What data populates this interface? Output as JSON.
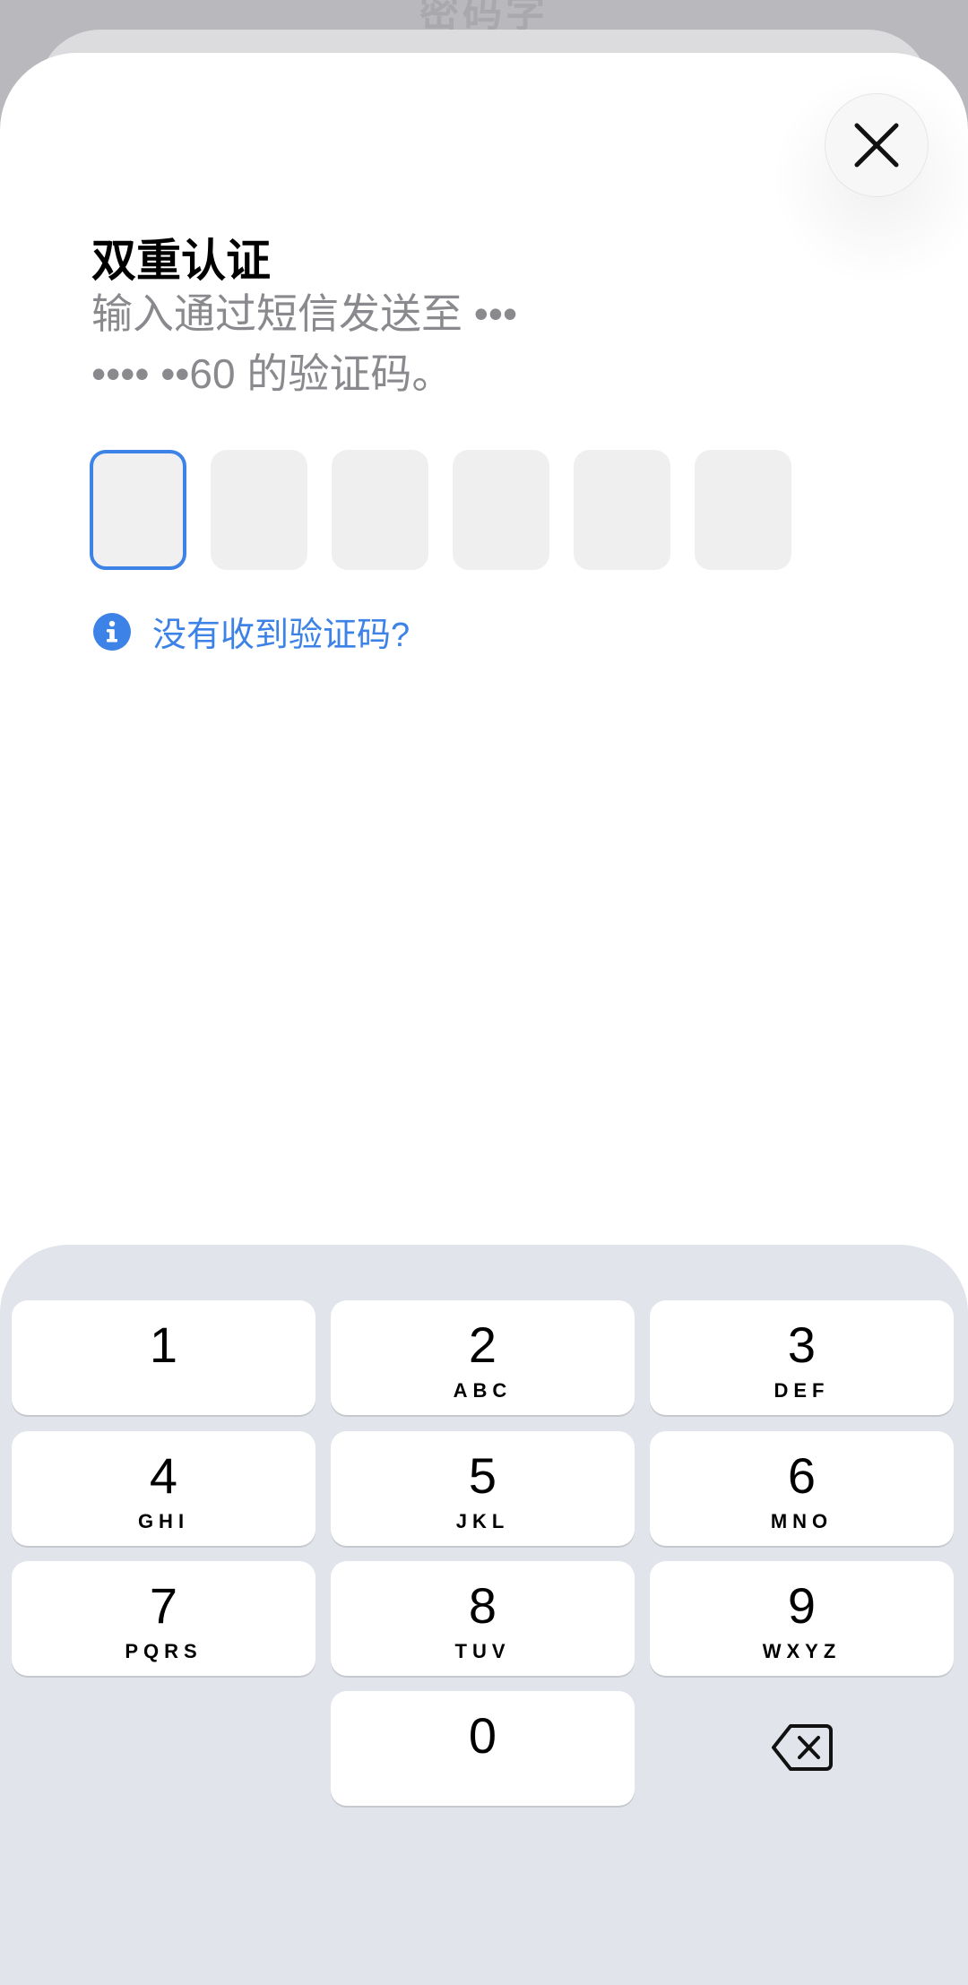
{
  "backdrop": {
    "title": "密码字"
  },
  "sheet": {
    "title": "双重认证",
    "subtitle_line1": "输入通过短信发送至 •••",
    "subtitle_line2": "•••• ••60 的验证码。",
    "code_digits": [
      "",
      "",
      "",
      "",
      "",
      ""
    ],
    "help_link": "没有收到验证码?",
    "icons": {
      "close": "close-icon",
      "info": "info-icon",
      "backspace": "backspace-icon"
    }
  },
  "keypad": {
    "keys": [
      {
        "num": "1",
        "letters": ""
      },
      {
        "num": "2",
        "letters": "ABC"
      },
      {
        "num": "3",
        "letters": "DEF"
      },
      {
        "num": "4",
        "letters": "GHI"
      },
      {
        "num": "5",
        "letters": "JKL"
      },
      {
        "num": "6",
        "letters": "MNO"
      },
      {
        "num": "7",
        "letters": "PQRS"
      },
      {
        "num": "8",
        "letters": "TUV"
      },
      {
        "num": "9",
        "letters": "WXYZ"
      },
      {
        "num": "0",
        "letters": ""
      }
    ]
  },
  "colors": {
    "accent": "#3d82e6",
    "keypad_bg": "#e1e4ea",
    "subtitle": "#8a8a8e"
  }
}
